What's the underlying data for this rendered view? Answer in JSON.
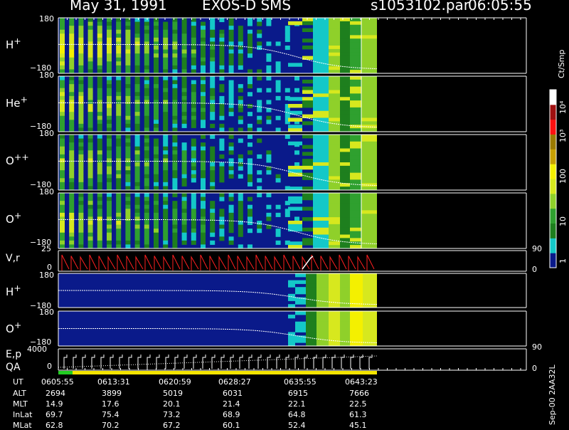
{
  "header": {
    "date": "May 31, 1991",
    "instrument": "EXOS-D SMS",
    "file": "s1053102.par",
    "time": "06:05:55"
  },
  "colorbar": {
    "unit_label": "Ct/Smp",
    "ticks": [
      "1",
      "10",
      "100",
      "10³",
      "10⁴"
    ],
    "colors": [
      "#0a1a8a",
      "#14c8c8",
      "#1e7f1e",
      "#2fa02f",
      "#8fd02a",
      "#d7e81e",
      "#f4f000",
      "#c8a000",
      "#9a7a00",
      "#ff1010",
      "#a01010",
      "#ffffff"
    ]
  },
  "panels": [
    {
      "ion": "H",
      "charge": "+",
      "top_tick": "180",
      "bottom_tick": "−180"
    },
    {
      "ion": "He",
      "charge": "+",
      "top_tick": "180",
      "bottom_tick": "−180"
    },
    {
      "ion": "O",
      "charge": "++",
      "top_tick": "180",
      "bottom_tick": "−180"
    },
    {
      "ion": "O",
      "charge": "+",
      "top_tick": "180",
      "bottom_tick": "−180"
    }
  ],
  "vr_panel": {
    "label": "V,r",
    "left_ticks": [
      "25",
      "0"
    ],
    "right_ticks": [
      "90",
      "0"
    ]
  },
  "lower_panels": [
    {
      "ion": "H",
      "charge": "+",
      "top_tick": "180",
      "bottom_tick": "−180"
    },
    {
      "ion": "O",
      "charge": "+",
      "top_tick": "180",
      "bottom_tick": "−180"
    }
  ],
  "ep_panel": {
    "label_top": "E,p",
    "label_bottom": "QA",
    "left_ticks": [
      "4000",
      "0"
    ],
    "right_ticks": [
      "90",
      "0"
    ]
  },
  "footer": {
    "rows": [
      {
        "label": "UT",
        "values": [
          "0605:55",
          "0613:31",
          "0620:59",
          "0628:27",
          "0635:55",
          "0643:23"
        ]
      },
      {
        "label": "ALT",
        "values": [
          "2694",
          "3899",
          "5019",
          "6031",
          "6915",
          "7666"
        ]
      },
      {
        "label": "MLT",
        "values": [
          "14.9",
          "17.6",
          "20.1",
          "21.4",
          "22.1",
          "22.5"
        ]
      },
      {
        "label": "InLat",
        "values": [
          "69.7",
          "75.4",
          "73.2",
          "68.9",
          "64.8",
          "61.3"
        ]
      },
      {
        "label": "MLat",
        "values": [
          "62.8",
          "70.2",
          "67.2",
          "60.1",
          "52.4",
          "45.1"
        ]
      }
    ],
    "version": "Sep-00 2AA32L"
  },
  "chart_data": {
    "type": "heatmap",
    "title": "May 31, 1991   EXOS-D SMS",
    "x": [
      "0605:55",
      "0613:31",
      "0620:59",
      "0628:27",
      "0635:55",
      "0643:23"
    ],
    "y_range": [
      -180,
      180
    ],
    "color_scale": "log",
    "color_range": [
      1,
      10000
    ],
    "color_label": "Ct/Smp",
    "panels": [
      "H+",
      "He+",
      "O++",
      "O+",
      "V,r",
      "H+",
      "O+",
      "E,p QA"
    ]
  }
}
